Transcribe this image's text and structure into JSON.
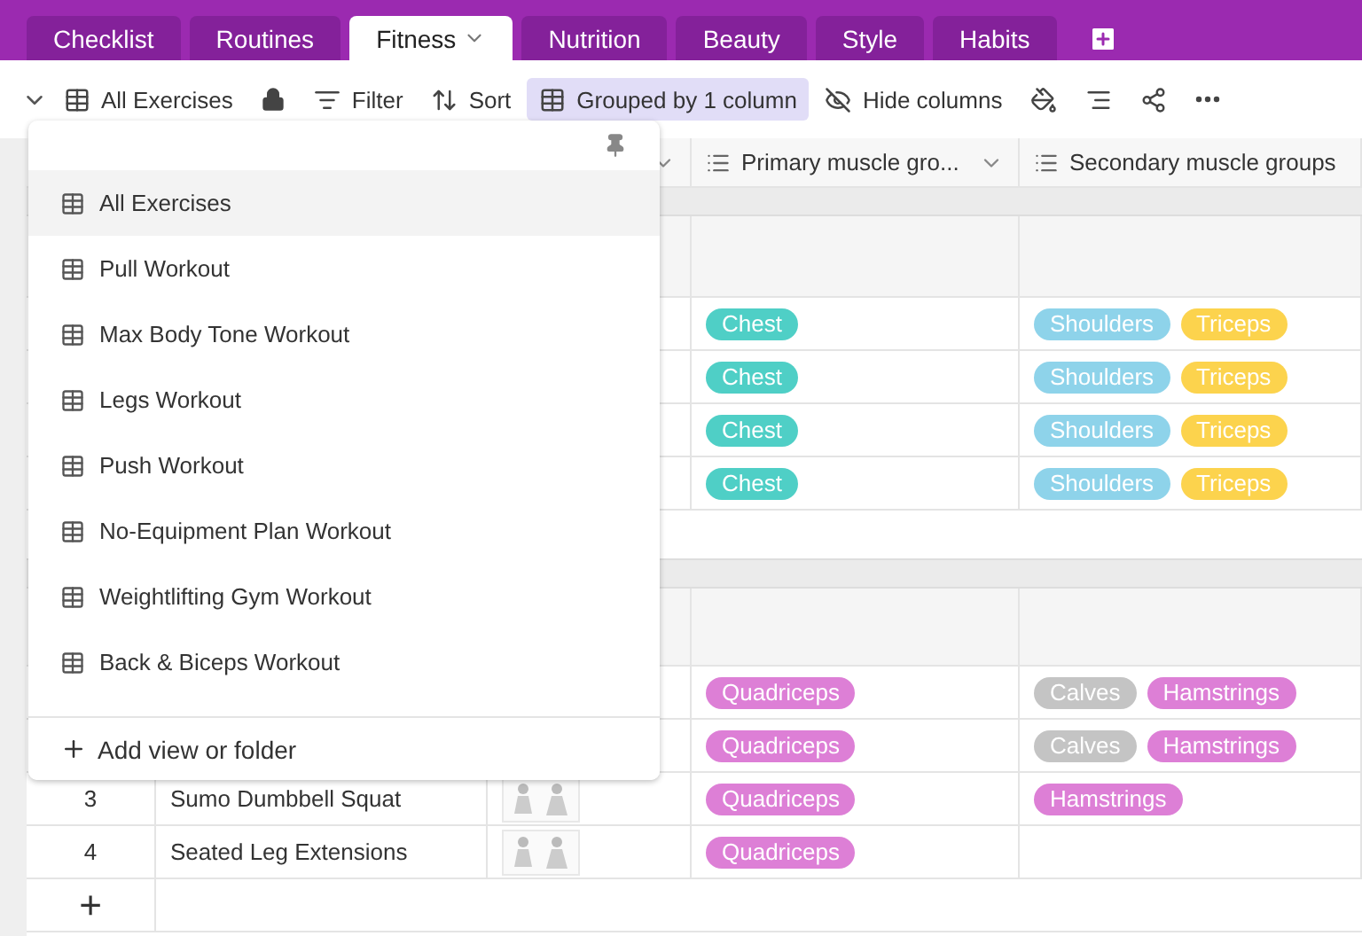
{
  "tabs": [
    {
      "label": "Checklist",
      "selected": false
    },
    {
      "label": "Routines",
      "selected": false
    },
    {
      "label": "Fitness",
      "selected": true
    },
    {
      "label": "Nutrition",
      "selected": false
    },
    {
      "label": "Beauty",
      "selected": false
    },
    {
      "label": "Style",
      "selected": false
    },
    {
      "label": "Habits",
      "selected": false
    }
  ],
  "toolbar": {
    "view": "All Exercises",
    "filter": "Filter",
    "sort": "Sort",
    "group": "Grouped by 1 column",
    "hide": "Hide columns"
  },
  "columns": [
    "Primary muscle gro...",
    "Secondary muscle groups"
  ],
  "groups": [
    {
      "rows": [
        {
          "primary": [
            {
              "label": "Chest",
              "color": "#4fcfc6"
            }
          ],
          "secondary": [
            {
              "label": "Shoulders",
              "color": "#8ed3ea"
            },
            {
              "label": "Triceps",
              "color": "#fcd34d"
            }
          ]
        },
        {
          "primary": [
            {
              "label": "Chest",
              "color": "#4fcfc6"
            }
          ],
          "secondary": [
            {
              "label": "Shoulders",
              "color": "#8ed3ea"
            },
            {
              "label": "Triceps",
              "color": "#fcd34d"
            }
          ]
        },
        {
          "primary": [
            {
              "label": "Chest",
              "color": "#4fcfc6"
            }
          ],
          "secondary": [
            {
              "label": "Shoulders",
              "color": "#8ed3ea"
            },
            {
              "label": "Triceps",
              "color": "#fcd34d"
            }
          ]
        },
        {
          "primary": [
            {
              "label": "Chest",
              "color": "#4fcfc6"
            }
          ],
          "secondary": [
            {
              "label": "Shoulders",
              "color": "#8ed3ea"
            },
            {
              "label": "Triceps",
              "color": "#fcd34d"
            }
          ]
        }
      ]
    },
    {
      "rows": [
        {
          "primary": [
            {
              "label": "Quadriceps",
              "color": "#dd7fd6"
            }
          ],
          "secondary": [
            {
              "label": "Calves",
              "color": "#c4c4c4"
            },
            {
              "label": "Hamstrings",
              "color": "#dd7fd6"
            }
          ]
        },
        {
          "primary": [
            {
              "label": "Quadriceps",
              "color": "#dd7fd6"
            }
          ],
          "secondary": [
            {
              "label": "Calves",
              "color": "#c4c4c4"
            },
            {
              "label": "Hamstrings",
              "color": "#dd7fd6"
            }
          ]
        },
        {
          "number": "3",
          "name": "Sumo Dumbbell Squat",
          "has_image": true,
          "primary": [
            {
              "label": "Quadriceps",
              "color": "#dd7fd6"
            }
          ],
          "secondary": [
            {
              "label": "Hamstrings",
              "color": "#dd7fd6"
            }
          ]
        },
        {
          "number": "4",
          "name": "Seated Leg Extensions",
          "has_image": true,
          "primary": [
            {
              "label": "Quadriceps",
              "color": "#dd7fd6"
            }
          ],
          "secondary": []
        }
      ]
    }
  ],
  "add_row": "+",
  "views_menu": {
    "items": [
      {
        "label": "All Exercises",
        "selected": true
      },
      {
        "label": "Pull Workout",
        "selected": false
      },
      {
        "label": "Max Body Tone Workout",
        "selected": false
      },
      {
        "label": "Legs Workout",
        "selected": false
      },
      {
        "label": "Push Workout",
        "selected": false
      },
      {
        "label": "No-Equipment Plan Workout",
        "selected": false
      },
      {
        "label": "Weightlifting Gym Workout",
        "selected": false
      },
      {
        "label": "Back & Biceps Workout",
        "selected": false
      }
    ],
    "add": "Add view or folder"
  }
}
